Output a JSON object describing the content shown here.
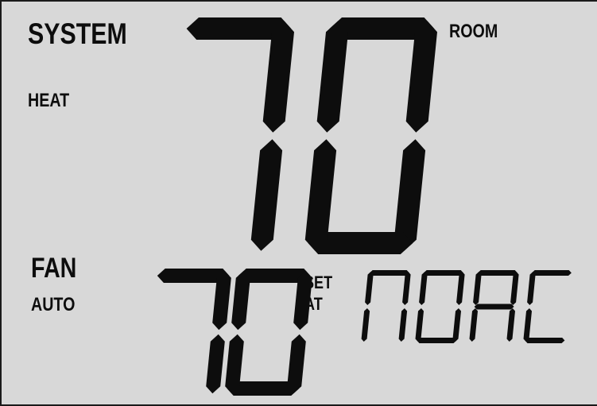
{
  "display": {
    "system_title": "SYSTEM",
    "system_mode": "HEAT",
    "fan_title": "FAN",
    "fan_mode": "AUTO",
    "room_label": "ROOM",
    "room_temperature": "70",
    "setpoint_temperature": "70",
    "set_label_line1": "SET",
    "set_label_line2": "AT",
    "status_text": "NOAC"
  },
  "colors": {
    "lcd_background": "#d8d8d8",
    "segment": "#0d0d0d",
    "frame": "#1a1a1a"
  }
}
